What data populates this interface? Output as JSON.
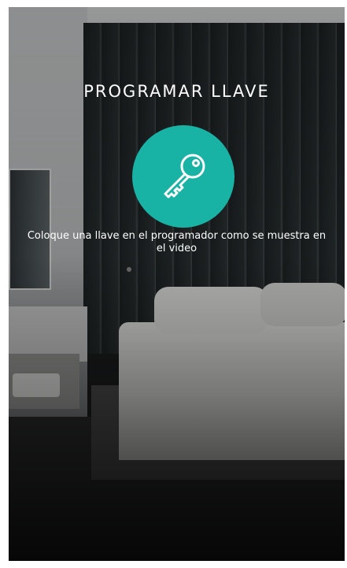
{
  "screen": {
    "title": "PROGRAMAR LLAVE",
    "icon": "key-icon",
    "instruction": "Coloque una llave en el programador como se muestra en el video",
    "accent_color": "#19b3a6"
  }
}
